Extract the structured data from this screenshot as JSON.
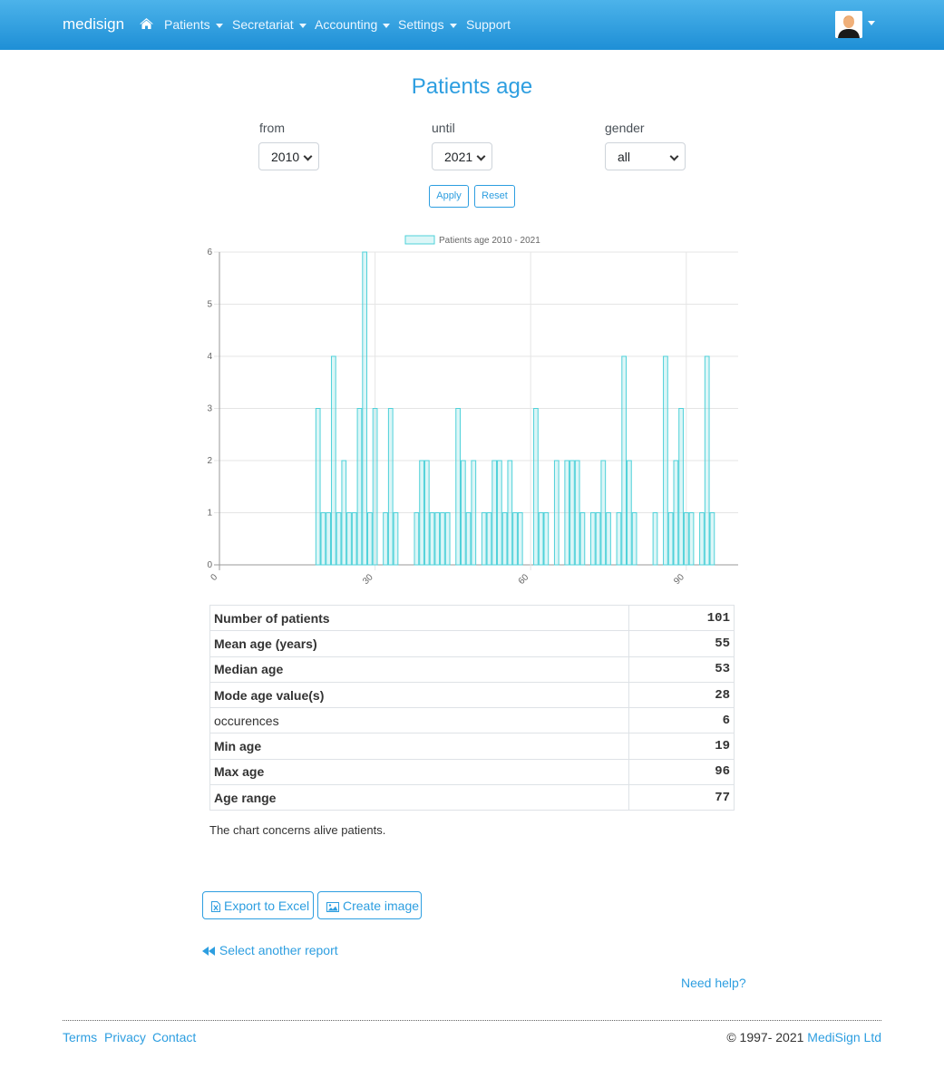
{
  "navbar": {
    "brand": "medisign",
    "items": [
      {
        "label": "Patients",
        "dropdown": true
      },
      {
        "label": "Secretariat",
        "dropdown": true
      },
      {
        "label": "Accounting",
        "dropdown": true
      },
      {
        "label": "Settings",
        "dropdown": true
      },
      {
        "label": "Support",
        "dropdown": false
      }
    ]
  },
  "page": {
    "title": "Patients age",
    "filters": {
      "from_label": "from",
      "from_value": "2010",
      "until_label": "until",
      "until_value": "2021",
      "gender_label": "gender",
      "gender_value": "all"
    },
    "apply_label": "Apply",
    "reset_label": "Reset"
  },
  "chart_data": {
    "type": "bar",
    "title": "",
    "legend": {
      "label": "Patients age 2010 - 2021",
      "placement": "top"
    },
    "xlabel": "",
    "ylabel": "",
    "xlim": [
      0,
      100
    ],
    "ylim": [
      0,
      6
    ],
    "yticks": [
      0,
      1,
      2,
      3,
      4,
      5,
      6
    ],
    "xticks": [
      0,
      30,
      60,
      90
    ],
    "grid": true,
    "color": "#4fd1d9",
    "fill": "rgba(79,209,217,0.2)",
    "x": [
      19,
      20,
      21,
      22,
      23,
      24,
      25,
      26,
      27,
      28,
      29,
      30,
      32,
      33,
      34,
      38,
      39,
      40,
      41,
      42,
      43,
      44,
      46,
      47,
      48,
      49,
      51,
      52,
      53,
      54,
      55,
      56,
      57,
      58,
      61,
      62,
      63,
      65,
      67,
      68,
      69,
      70,
      72,
      73,
      74,
      75,
      77,
      78,
      79,
      80,
      84,
      86,
      87,
      88,
      89,
      90,
      91,
      93,
      94,
      95
    ],
    "values": [
      3,
      1,
      1,
      4,
      1,
      2,
      1,
      1,
      3,
      6,
      1,
      3,
      1,
      3,
      1,
      1,
      2,
      2,
      1,
      1,
      1,
      1,
      3,
      2,
      1,
      2,
      1,
      1,
      2,
      2,
      1,
      2,
      1,
      1,
      3,
      1,
      1,
      2,
      2,
      2,
      2,
      1,
      1,
      1,
      2,
      1,
      1,
      4,
      2,
      1,
      1,
      4,
      1,
      2,
      3,
      1,
      1,
      1,
      4,
      1
    ]
  },
  "stats": [
    {
      "label": "Number of patients",
      "value": "101",
      "bold": true
    },
    {
      "label": "Mean age (years)",
      "value": "55",
      "bold": true
    },
    {
      "label": "Median age",
      "value": "53",
      "bold": true
    },
    {
      "label": "Mode age value(s)",
      "value": "28",
      "bold": true
    },
    {
      "label": "occurences",
      "value": "6",
      "bold": false
    },
    {
      "label": "Min age",
      "value": "19",
      "bold": true
    },
    {
      "label": "Max age",
      "value": "96",
      "bold": true
    },
    {
      "label": "Age range",
      "value": "77",
      "bold": true
    }
  ],
  "note": "The chart concerns alive patients.",
  "actions": {
    "export_excel": "Export to Excel",
    "create_image": "Create image",
    "select_report": "Select another report",
    "help": "Need help?"
  },
  "footer": {
    "terms": "Terms",
    "privacy": "Privacy",
    "contact": "Contact",
    "copyright_prefix": "© 1997- 2021 ",
    "company": "MediSign Ltd"
  },
  "colors": {
    "accent": "#2d9ee0",
    "navbar": "#2d9ee0"
  }
}
